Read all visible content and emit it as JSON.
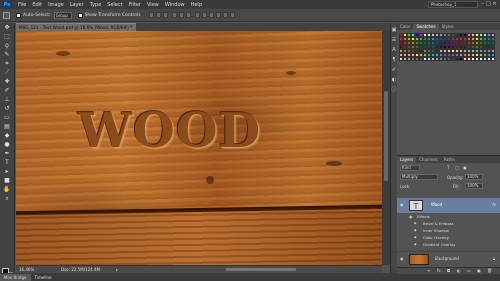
{
  "app": {
    "logo": "Ps",
    "workspace": "Photoshop_1"
  },
  "menu": [
    "File",
    "Edit",
    "Image",
    "Layer",
    "Type",
    "Select",
    "Filter",
    "View",
    "Window",
    "Help"
  ],
  "window_controls": {
    "minimize": "–",
    "restore": "□",
    "close": "✕"
  },
  "options": {
    "auto_select_label": "Auto-Select:",
    "auto_select_value": "Group",
    "transform_label": "Show Transform Controls"
  },
  "document": {
    "tab_title": "MSG_121 - Text Wood.psd @ 16.6% (Wood, RGB/8#) *",
    "canvas_text": "WOOD"
  },
  "status": {
    "zoom": "16.46%",
    "doc_size": "Doc: 22.5M/124.4M"
  },
  "bottom_tabs": [
    "Mini Bridge",
    "Timeline"
  ],
  "swatches_panel": {
    "tabs": [
      "Color",
      "Swatches",
      "Styles"
    ],
    "active_tab": "Swatches"
  },
  "layers_panel": {
    "tabs": [
      "Layers",
      "Channels",
      "Paths"
    ],
    "active_tab": "Layers",
    "kind_label": "Kind",
    "blend_mode": "Multiply",
    "opacity_label": "Opacity:",
    "opacity_value": "100%",
    "lock_label": "Lock:",
    "fill_label": "Fill:",
    "fill_value": "100%",
    "layers": [
      {
        "name": "Wood",
        "type": "text",
        "selected": true,
        "fx": "fx"
      },
      {
        "name": "Background",
        "type": "image",
        "selected": false
      }
    ],
    "effects_label": "Effects",
    "effects": [
      "Bevel & Emboss",
      "Inner Shadow",
      "Color Overlay",
      "Gradient Overlay"
    ]
  },
  "colors": {
    "accent_selected": "#6a7fa0",
    "wood": "#b8692a",
    "swatch_rows": [
      [
        "#ff0000",
        "#ffff00",
        "#00ff00",
        "#00ffff",
        "#0000ff",
        "#ff00ff",
        "#ffffff",
        "#e6e6e6",
        "#cccccc",
        "#b3b3b3",
        "#999999",
        "#808080",
        "#666666",
        "#4d4d4d",
        "#333333",
        "#1a1a1a",
        "#000000",
        "#ff8080",
        "#ffbf80",
        "#ffff80",
        "#80ff80",
        "#80ffff",
        "#8080ff",
        "#ff80ff"
      ],
      [
        "#ed1c24",
        "#f26522",
        "#f7941d",
        "#fff200",
        "#8dc63f",
        "#39b54a",
        "#00a651",
        "#00a99d",
        "#00aeef",
        "#0072bc",
        "#0054a6",
        "#2e3192",
        "#662d91",
        "#92278f",
        "#ec008c",
        "#ed145b",
        "#c1272d",
        "#d96c27",
        "#e8a028",
        "#f2e429",
        "#7bb33e",
        "#2d9c47",
        "#1e8b5a",
        "#00958c"
      ],
      [
        "#9e0b0f",
        "#a0410d",
        "#a36209",
        "#aba000",
        "#598527",
        "#197b30",
        "#007236",
        "#00746b",
        "#0076a3",
        "#004b80",
        "#003471",
        "#1b1464",
        "#440e62",
        "#630460",
        "#9e005d",
        "#9e0039",
        "#7b1e1e",
        "#8b4a1a",
        "#9c6e1c",
        "#a69a1a",
        "#4e7a22",
        "#1a6a2c",
        "#126137",
        "#006a62"
      ],
      [
        "#790000",
        "#7b2e00",
        "#7d4900",
        "#827b00",
        "#406618",
        "#005e20",
        "#005826",
        "#005952",
        "#005b7f",
        "#003663",
        "#002157",
        "#0d004c",
        "#32004b",
        "#4b0049",
        "#7b0046",
        "#7a0026",
        "#5a1414",
        "#663412",
        "#6e4c12",
        "#7a7112",
        "#395a18",
        "#0e4c1e",
        "#0a4828",
        "#004e48"
      ],
      [
        "#c69c6d",
        "#a67c52",
        "#8c6239",
        "#754c24",
        "#603913",
        "#3c2415",
        "#998675",
        "#736357",
        "#534741",
        "#362f2d",
        "#fbaf5d",
        "#f9ad81",
        "#fdc68a",
        "#fff799",
        "#c4df9b",
        "#a3d39c",
        "#82ca9d",
        "#7accc8",
        "#6dcff6",
        "#7da7d9",
        "#8393ca",
        "#8781bd",
        "#a186be",
        "#bd8cbf"
      ],
      [
        "#f49ac1",
        "#f6989d",
        "#f7977a",
        "#fbaf5d",
        "#fff568",
        "#acd372",
        "#7cc576",
        "#3bb878",
        "#1abbb4",
        "#00bff3",
        "#438ccb",
        "#5574b9",
        "#605ca8",
        "#855fa8",
        "#a763a8",
        "#f06eaa",
        "#f26c4f",
        "#f68e55",
        "#fcb040",
        "#fff200",
        "#a6ce39",
        "#57b947",
        "#00a99d",
        "#00aeef"
      ],
      [
        "#e8d4b8",
        "#d7b98e",
        "#c09a6b",
        "#a57d52",
        "#8a6239",
        "#6e4b2b",
        "#f2f2f2",
        "#d9d9d9",
        "#bfbfbf",
        "#a6a6a6",
        "#8c8c8c",
        "#737373",
        "#595959",
        "#404040",
        "#262626",
        "#0d0d0d",
        "#ffd9d9",
        "#ffe6cc",
        "#ffffcc",
        "#d9ffd9",
        "#ccffff",
        "#d9d9ff",
        "#ffd9ff",
        "#ffffff"
      ]
    ]
  }
}
